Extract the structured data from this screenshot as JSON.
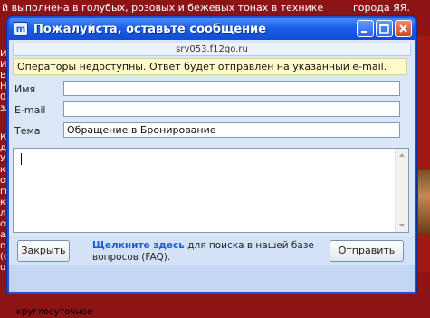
{
  "background": {
    "top_text": "й выполнена в голубых, розовых и бежевых тонах в технике",
    "right_text": "города     ЯЯ.",
    "left_top_text": "И» ИЙ Во Н. 0 зл",
    "left_text": "Ко дв У. ки об ги км ли об ал п (с uit",
    "bottom_text": "круглосуточное"
  },
  "window": {
    "title": "Пожалуйста, оставьте сообщение",
    "app_icon_glyph": "m",
    "url": "srv053.f12go.ru",
    "notice": "Операторы недоступны. Ответ будет отправлен на указанный e-mail.",
    "fields": {
      "name_label": "Имя",
      "name_value": "",
      "email_label": "E-mail",
      "email_value": "",
      "subject_label": "Тема",
      "subject_value": "Обращение в Бронирование"
    },
    "message_value": "",
    "close_button": "Закрыть",
    "faq_link": "Щелкните здесь",
    "faq_text": " для поиска в нашей базе вопросов (FAQ).",
    "send_button": "Отправить"
  },
  "colors": {
    "title_bar": "#1c5ee6",
    "page_bg": "#8c1414",
    "notice_bg": "#fffcc8",
    "link": "#1b5bd0"
  }
}
